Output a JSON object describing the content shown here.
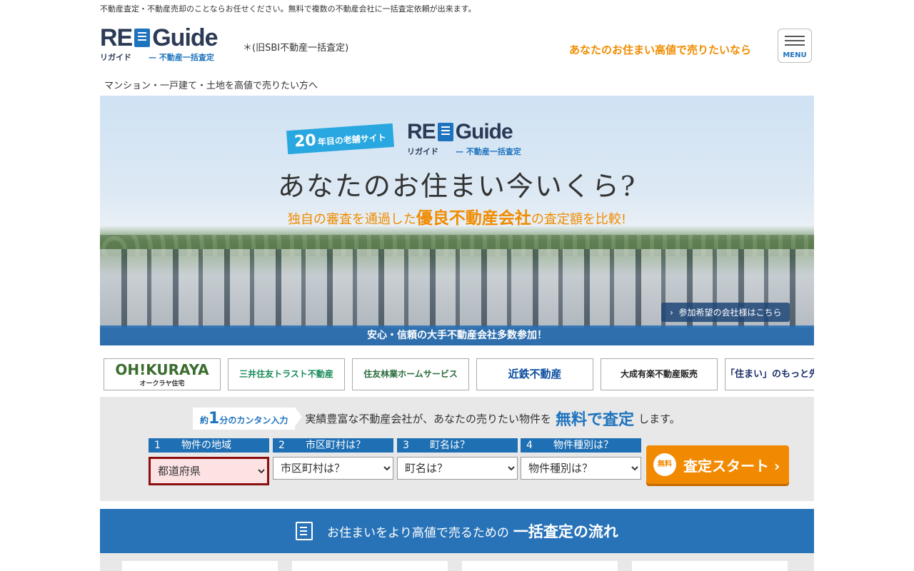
{
  "header": {
    "tagline": "不動産査定・不動産売却のことならお任せください。無料で複数の不動産会社に一括査定依頼が出来ます。",
    "logo_word_left": "RE",
    "logo_word_right": "Guide",
    "logo_sub_left": "リガイド",
    "logo_sub_right": "— 不動産一括査定",
    "formerly": "＊(旧SBI不動産一括査定)",
    "cta_text": "あなたのお住まい高値で売りたいなら",
    "menu_label": "MENU"
  },
  "subheading": "マンション・一戸建て・土地を高値で売りたい方へ",
  "hero": {
    "badge_number": "20",
    "badge_text": "年目の老舗サイト",
    "title": "あなたのお住まい今いくら?",
    "sub_pre": "独自の審査を通過した",
    "sub_highlight": "優良不動産会社",
    "sub_post": "の査定額を比較!",
    "partner_link": "参加希望の会社様はこちら",
    "band_text": "安心・信頼の大手不動産会社多数参加！"
  },
  "partner_logos": [
    {
      "name": "OH!KURAYA",
      "sub": "オークラヤ住宅"
    },
    {
      "name": "三井住友トラスト不動産"
    },
    {
      "name": "住友林業ホームサービス"
    },
    {
      "name": "近鉄不動産"
    },
    {
      "name": "大成有楽不動産販売"
    },
    {
      "name": "「住まい」のもっと先へ。 TOHO HOU"
    }
  ],
  "form": {
    "quick_prefix": "約",
    "quick_number": "1",
    "quick_suffix": "分のカンタン入力",
    "lead_pre": "実績豊富な不動産会社が、あなたの売りたい物件を",
    "lead_free": "無料で査定",
    "lead_post": "します。",
    "steps": [
      {
        "num": "1",
        "label": "物件の地域",
        "value": "都道府県"
      },
      {
        "num": "2",
        "label": "市区町村は？",
        "value": "市区町村は？"
      },
      {
        "num": "3",
        "label": "町名は？",
        "value": "町名は？"
      },
      {
        "num": "4",
        "label": "物件種別は？",
        "value": "物件種別は？"
      }
    ],
    "start_badge": "無料",
    "start_label": "査定スタート ›"
  },
  "flow": {
    "small_text": "お住まいをより高値で売るための",
    "big_text": "一括査定の流れ"
  },
  "colors": {
    "brand_blue": "#1e73be",
    "accent_orange": "#f08c00",
    "logo_navy": "#2b3a55",
    "step_header_blue": "#1e6fb4",
    "selected_border": "#8b0d0d"
  },
  "icons": [
    "menu-icon",
    "book-logo-icon",
    "chevron-right-icon",
    "pencil-note-icon"
  ]
}
